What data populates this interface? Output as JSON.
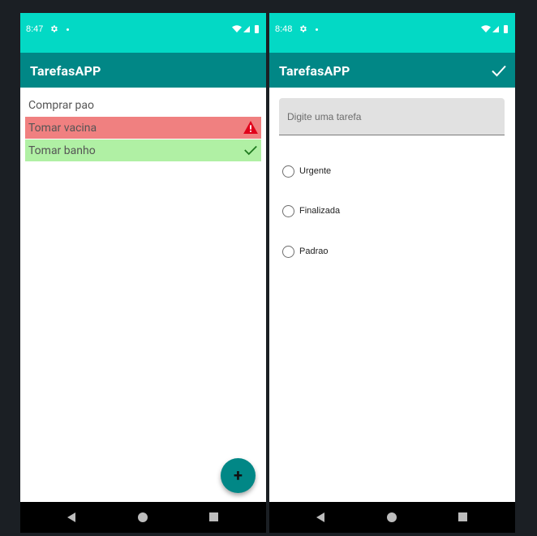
{
  "colors": {
    "status_bar": "#03d9c5",
    "app_bar": "#018786",
    "urgent_row": "#f08080",
    "done_row": "#b0f0a4",
    "warning_icon": "#e0001a",
    "done_icon": "#1f7a1f"
  },
  "left_screen": {
    "status_bar": {
      "time": "8:47",
      "icons": [
        "gear-icon",
        "dot-icon",
        "wifi-icon",
        "signal-icon",
        "battery-icon"
      ]
    },
    "app_bar": {
      "title": "TarefasAPP"
    },
    "tasks": [
      {
        "label": "Comprar pao",
        "status": "padrao",
        "icon": null
      },
      {
        "label": "Tomar vacina",
        "status": "urgente",
        "icon": "warning-icon"
      },
      {
        "label": "Tomar banho",
        "status": "finalizada",
        "icon": "check-icon"
      }
    ],
    "fab": {
      "label": "+"
    },
    "nav_bar": {
      "buttons": [
        "back-icon",
        "home-icon",
        "recents-icon"
      ]
    }
  },
  "right_screen": {
    "status_bar": {
      "time": "8:48",
      "icons": [
        "gear-icon",
        "dot-icon",
        "wifi-icon",
        "signal-icon",
        "battery-icon"
      ]
    },
    "app_bar": {
      "title": "TarefasAPP",
      "action_icon": "check-icon"
    },
    "task_input": {
      "placeholder": "Digite uma tarefa",
      "value": ""
    },
    "radio_options": [
      {
        "label": "Urgente",
        "selected": false
      },
      {
        "label": "Finalizada",
        "selected": false
      },
      {
        "label": "Padrao",
        "selected": false
      }
    ],
    "nav_bar": {
      "buttons": [
        "back-icon",
        "home-icon",
        "recents-icon"
      ]
    }
  }
}
